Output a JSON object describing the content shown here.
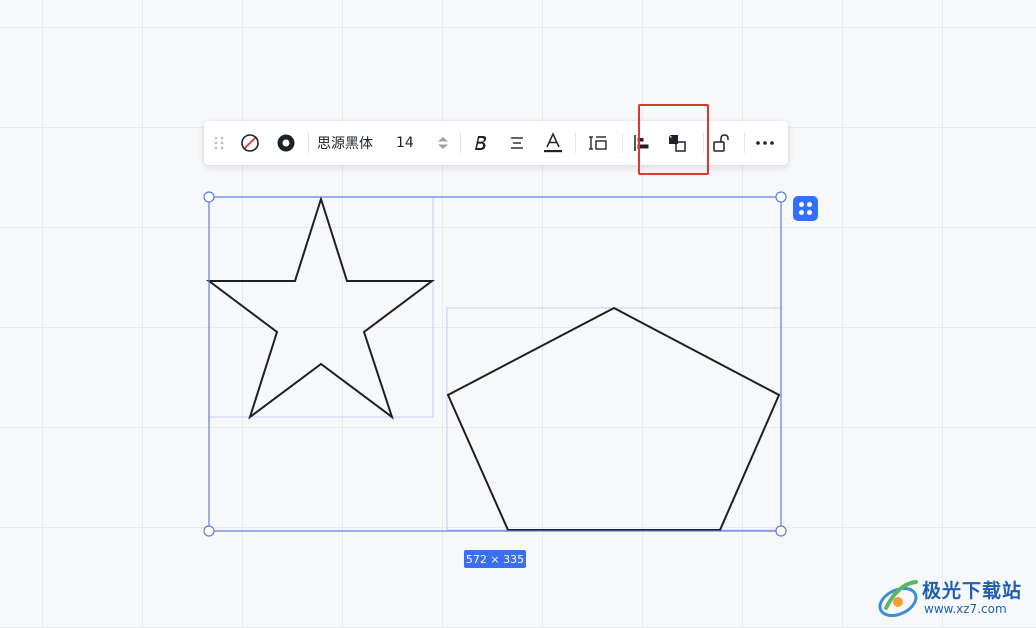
{
  "toolbar": {
    "font_name": "思源黑体",
    "font_size": "14",
    "items": [
      "drag-handle",
      "no-fill",
      "border-style",
      "font-family",
      "font-size",
      "bold",
      "align",
      "text-color",
      "text-box",
      "align-shapes",
      "group",
      "lock",
      "more"
    ]
  },
  "selection": {
    "size_label": "572 × 335"
  },
  "canvas": {
    "shapes": [
      "star",
      "pentagon"
    ]
  },
  "watermark": {
    "title": "极光下载站",
    "url": "www.xz7.com"
  },
  "colors": {
    "accent": "#3370ff",
    "selection_line": "#5b7ee5",
    "highlight": "#e1362b",
    "shape_stroke": "#1f1f1f"
  }
}
